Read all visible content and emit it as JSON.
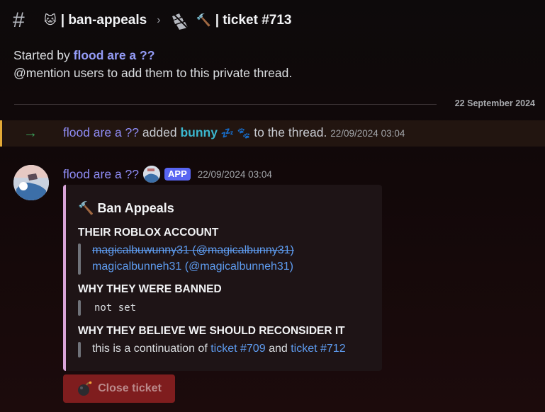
{
  "header": {
    "hash_icon": "hash-icon",
    "channel_emoji": "🐱",
    "channel_name": "| ban-appeals",
    "separator": "›",
    "thread_emoji": "🔨",
    "thread_name": "| ticket #713"
  },
  "intro": {
    "started_prefix": "Started by",
    "started_name": "flood are a ??",
    "hint": "@mention users to add them to this private thread."
  },
  "date_divider": "22 September 2024",
  "system_message": {
    "actor": "flood are a ??",
    "verb": "added",
    "target": "bunny",
    "target_emoji": "💤 🐾",
    "suffix": "to the thread.",
    "timestamp": "22/09/2024 03:04"
  },
  "message": {
    "author": "flood are a ??",
    "badge": "APP",
    "timestamp": "22/09/2024 03:04",
    "embed": {
      "title_emoji": "🔨",
      "title": "Ban Appeals",
      "fields": [
        {
          "name": "THEIR ROBLOX ACCOUNT",
          "lines": [
            "magicalbuwunny31 (@magicalbunny31)",
            "magicalbunneh31 (@magicalbunneh31)"
          ]
        },
        {
          "name": "WHY THEY WERE BANNED",
          "lines": [
            "not set"
          ]
        },
        {
          "name": "WHY THEY BELIEVE WE SHOULD RECONSIDER IT",
          "text_prefix": "this is a continuation of",
          "link1": "ticket #709",
          "and": "and",
          "link2": "ticket #712"
        }
      ]
    },
    "button": {
      "label": "Close ticket",
      "icon": "bomb-icon"
    }
  },
  "colors": {
    "accent": "#5865f2",
    "mention": "#949cf7",
    "link": "#5e9cf0",
    "embed_border": "#d9a5d9",
    "danger": "#7f1d1e",
    "system_border": "#e3a936"
  }
}
